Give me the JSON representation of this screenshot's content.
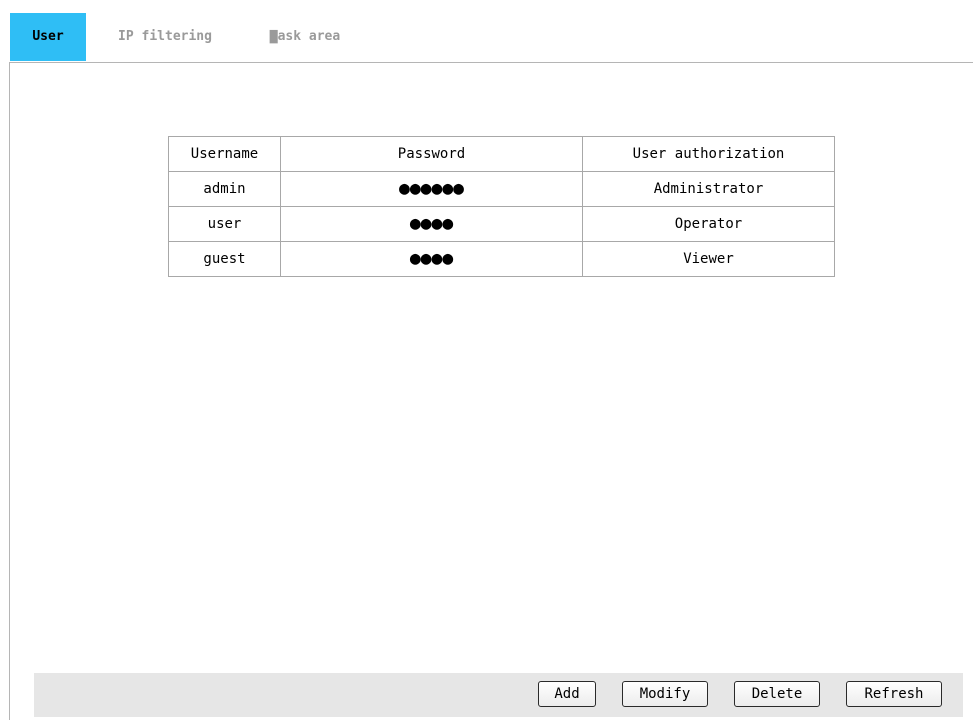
{
  "tabs": [
    {
      "label": "User",
      "active": true
    },
    {
      "label": "IP filtering",
      "active": false
    },
    {
      "label": "▇ask area",
      "active": false
    }
  ],
  "table": {
    "headers": [
      "Username",
      "Password",
      "User authorization"
    ],
    "rows": [
      {
        "username": "admin",
        "password": "●●●●●●",
        "authorization": "Administrator"
      },
      {
        "username": "user",
        "password": "●●●●",
        "authorization": "Operator"
      },
      {
        "username": "guest",
        "password": "●●●●",
        "authorization": "Viewer"
      }
    ]
  },
  "buttons": {
    "add": "Add",
    "modify": "Modify",
    "delete": "Delete",
    "refresh": "Refresh"
  },
  "colors": {
    "active_tab": "#2fbef5",
    "inactive_tab_text": "#9a9a9a",
    "button_bar": "#e6e6e6"
  }
}
